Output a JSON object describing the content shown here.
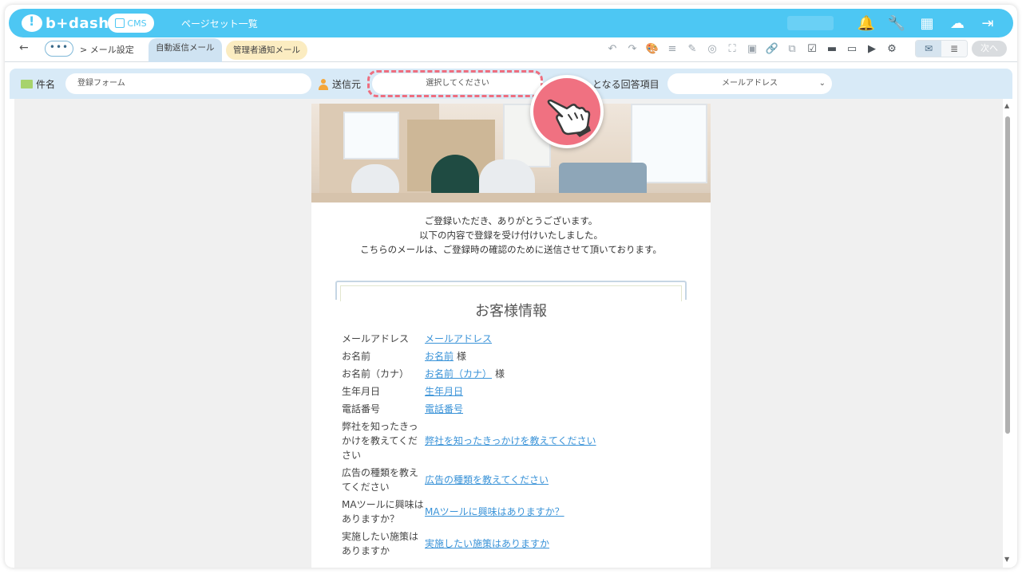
{
  "app": {
    "logo_text": "b+dash",
    "cms_label": "CMS",
    "page_set_link": "ページセット一覧"
  },
  "topbar": {
    "icons": [
      "bell-icon",
      "wrench-icon",
      "grid-icon",
      "cloud-icon",
      "logout-icon"
    ],
    "icon_glyphs": [
      "🔔",
      "🔧",
      "▦",
      "☁",
      "⇥"
    ]
  },
  "breadcrumb": {
    "back": "←",
    "dots": "•••",
    "current": "> メール設定"
  },
  "tabs": {
    "auto_reply": "自動返信メール",
    "admin_notify": "管理者通知メール"
  },
  "toolbar": {
    "icons": [
      "undo-icon",
      "redo-icon",
      "palette-icon",
      "align-icon",
      "pen-icon",
      "target-icon",
      "fullscreen-icon",
      "image-icon",
      "link-icon",
      "copy-image-icon",
      "checkbox-icon",
      "divider-icon",
      "window-icon",
      "play-icon",
      "gear-icon"
    ],
    "glyphs": [
      "↶",
      "↷",
      "🎨",
      "≡",
      "✎",
      "◎",
      "⛶",
      "▣",
      "🔗",
      "⧉",
      "☑",
      "▬",
      "▭",
      "▶",
      "⚙"
    ],
    "view_mail": "✉",
    "view_text": "≣",
    "next_label": "次へ"
  },
  "settings": {
    "subject_label": "件名",
    "subject_value": "登録フォーム",
    "sender_label": "送信元",
    "sender_placeholder": "選択してください",
    "target_label": "となる回答項目",
    "target_value": "メールアドレス",
    "target_chevron": "⌄"
  },
  "mail": {
    "greeting": [
      "ご登録いただき、ありがとうございます。",
      "以下の内容で登録を受け付けいたしました。",
      "こちらのメールは、ご登録時の確認のために送信させて頂いております。"
    ],
    "info_title": "お客様情報",
    "rows": [
      {
        "key": "メールアドレス",
        "value": "メールアドレス",
        "suffix": ""
      },
      {
        "key": "お名前",
        "value": "お名前",
        "suffix": "様"
      },
      {
        "key": "お名前（カナ）",
        "value": "お名前（カナ）",
        "suffix": "様"
      },
      {
        "key": "生年月日",
        "value": "生年月日",
        "suffix": ""
      },
      {
        "key": "電話番号",
        "value": "電話番号",
        "suffix": ""
      },
      {
        "key": "弊社を知ったきっかけを教えてください",
        "value": "弊社を知ったきっかけを教えてください",
        "suffix": ""
      },
      {
        "key": "広告の種類を教えてください",
        "value": "広告の種類を教えてください",
        "suffix": ""
      },
      {
        "key": "MAツールに興味はありますか？",
        "value": "MAツールに興味はありますか？",
        "suffix": ""
      },
      {
        "key": "実施したい施策はありますか",
        "value": "実施したい施策はありますか",
        "suffix": ""
      }
    ]
  },
  "colors": {
    "topbar": "#4dc7f3",
    "settings_bar": "#d8eaf7",
    "highlight": "#ee6e7f",
    "link": "#3a93d8"
  }
}
